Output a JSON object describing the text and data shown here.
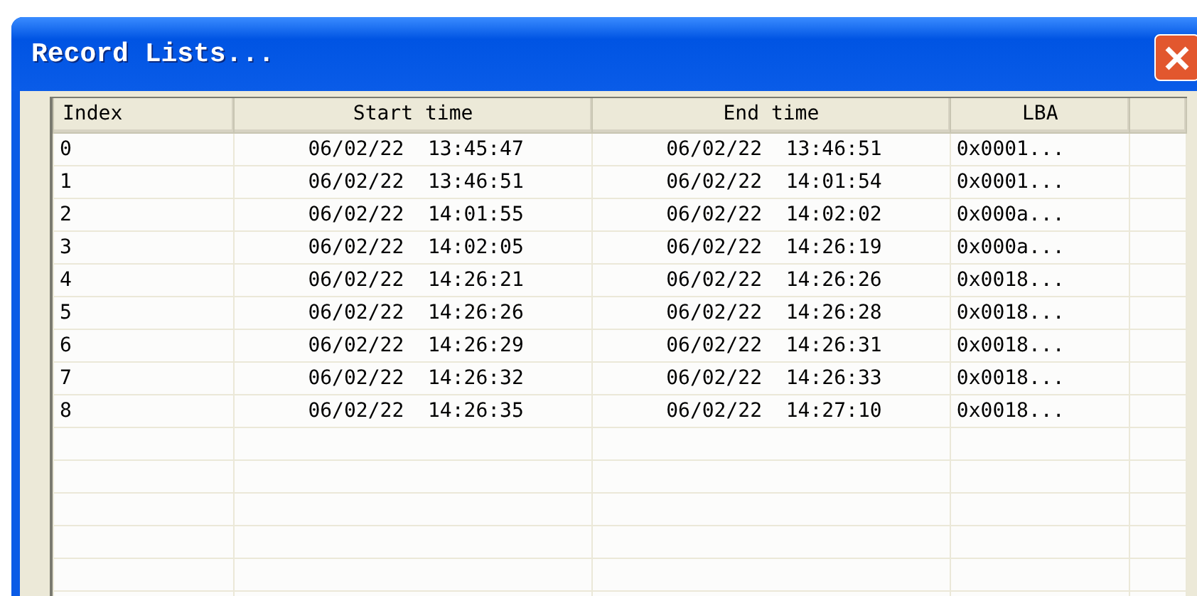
{
  "window": {
    "title": "Record Lists..."
  },
  "table": {
    "columns": [
      "Index",
      "Start time",
      "End time",
      "LBA"
    ],
    "rows": [
      [
        "0",
        "06/02/22  13:45:47",
        "06/02/22  13:46:51",
        "0x0001..."
      ],
      [
        "1",
        "06/02/22  13:46:51",
        "06/02/22  14:01:54",
        "0x0001..."
      ],
      [
        "2",
        "06/02/22  14:01:55",
        "06/02/22  14:02:02",
        "0x000a..."
      ],
      [
        "3",
        "06/02/22  14:02:05",
        "06/02/22  14:26:19",
        "0x000a..."
      ],
      [
        "4",
        "06/02/22  14:26:21",
        "06/02/22  14:26:26",
        "0x0018..."
      ],
      [
        "5",
        "06/02/22  14:26:26",
        "06/02/22  14:26:28",
        "0x0018..."
      ],
      [
        "6",
        "06/02/22  14:26:29",
        "06/02/22  14:26:31",
        "0x0018..."
      ],
      [
        "7",
        "06/02/22  14:26:32",
        "06/02/22  14:26:33",
        "0x0018..."
      ],
      [
        "8",
        "06/02/22  14:26:35",
        "06/02/22  14:27:10",
        "0x0018..."
      ]
    ]
  }
}
